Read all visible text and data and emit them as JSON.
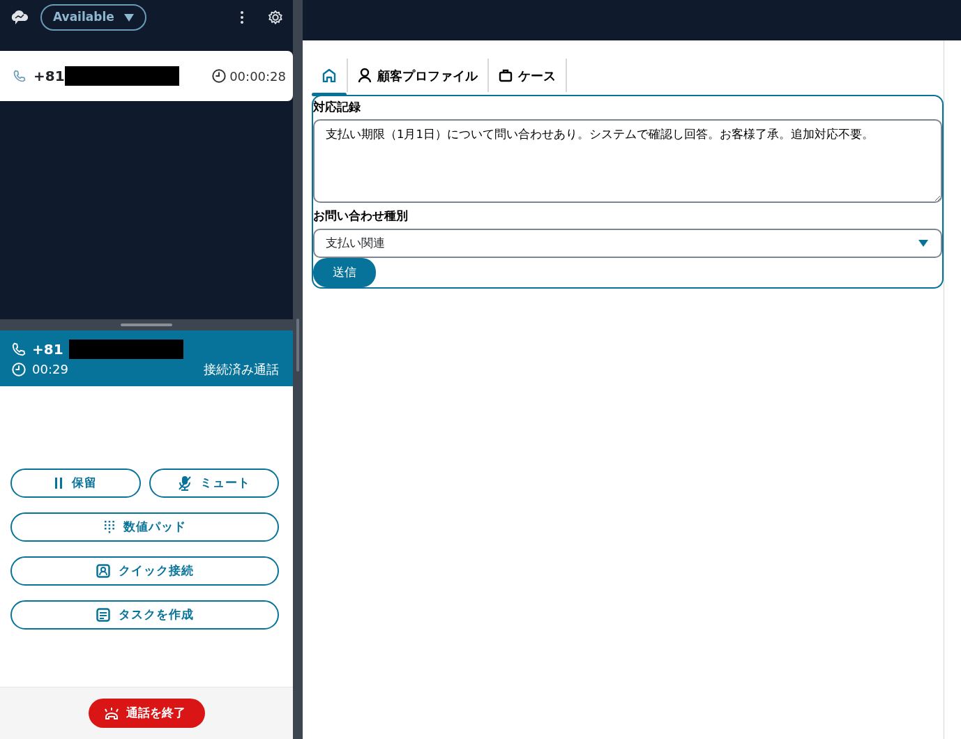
{
  "top_bar": {
    "status": "Available"
  },
  "incoming_call": {
    "phone": "+81",
    "timer": "00:00:28"
  },
  "active_call": {
    "phone": "+81",
    "duration": "00:29",
    "state": "接続済み通話"
  },
  "call_controls": [
    {
      "kind": "pause",
      "label": "保留"
    },
    {
      "kind": "mute",
      "label": "ミュート"
    },
    {
      "kind": "keypad",
      "label": "数値パッド"
    },
    {
      "kind": "contact",
      "label": "クイック接続"
    },
    {
      "kind": "task",
      "label": "タスクを作成"
    }
  ],
  "end_call": {
    "label": "通話を終了"
  },
  "tabs": [
    {
      "kind": "home",
      "selected": true
    },
    {
      "kind": "person",
      "label": "顧客プロファイル",
      "selected": false
    },
    {
      "kind": "case",
      "label": "ケース",
      "selected": false
    }
  ],
  "form": {
    "notes_label": "対応記録",
    "notes_value": "支払い期限（1月1日）について問い合わせあり。システムで確認し回答。お客様了承。追加対応不要。",
    "type_label": "お問い合わせ種別",
    "type_value": "支払い関連",
    "submit": "送信"
  }
}
